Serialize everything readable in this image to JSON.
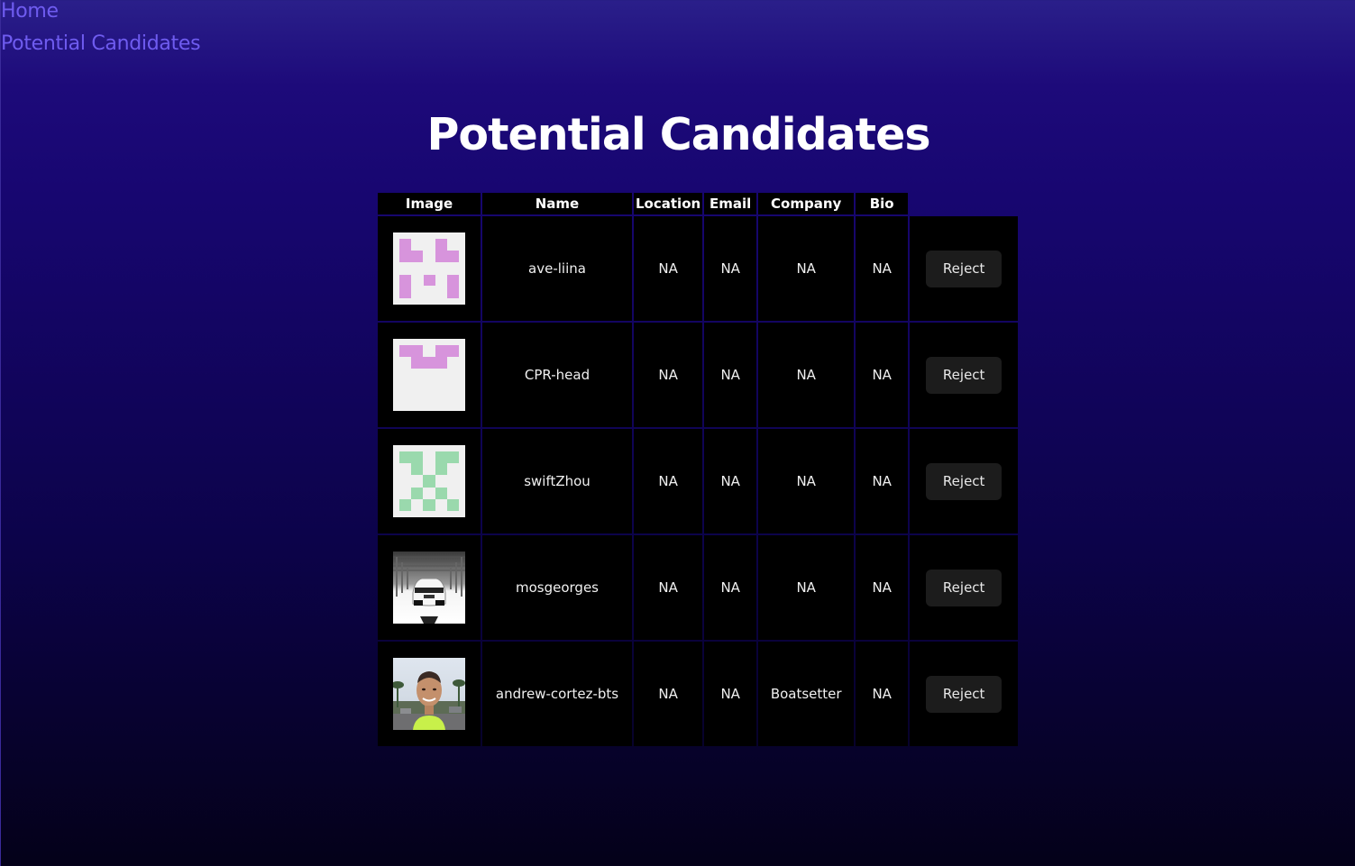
{
  "nav": {
    "home_label": "Home",
    "candidates_label": "Potential Candidates"
  },
  "page": {
    "title": "Potential Candidates"
  },
  "table": {
    "headers": [
      "Image",
      "Name",
      "Location",
      "Email",
      "Company",
      "Bio"
    ],
    "rows": [
      {
        "avatar": "identicon-pink-pattern-1",
        "name": "ave-liina",
        "location": "NA",
        "email": "NA",
        "company": "NA",
        "bio": "NA",
        "action": "Reject"
      },
      {
        "avatar": "identicon-pink-pattern-2",
        "name": "CPR-head",
        "location": "NA",
        "email": "NA",
        "company": "NA",
        "bio": "NA",
        "action": "Reject"
      },
      {
        "avatar": "identicon-green-pattern",
        "name": "swiftZhou",
        "location": "NA",
        "email": "NA",
        "company": "NA",
        "bio": "NA",
        "action": "Reject"
      },
      {
        "avatar": "photo-white-sports-car",
        "name": "mosgeorges",
        "location": "NA",
        "email": "NA",
        "company": "NA",
        "bio": "NA",
        "action": "Reject"
      },
      {
        "avatar": "photo-man-portrait",
        "name": "andrew-cortez-bts",
        "location": "NA",
        "email": "NA",
        "company": "Boatsetter",
        "bio": "NA",
        "action": "Reject"
      }
    ]
  },
  "colors": {
    "nav_link": "#6f5cf0",
    "identicon_pink": "#d794dc",
    "identicon_green": "#9ad9ad",
    "identicon_bg": "#f0f0f0",
    "button_bg": "#1c1c1c"
  }
}
